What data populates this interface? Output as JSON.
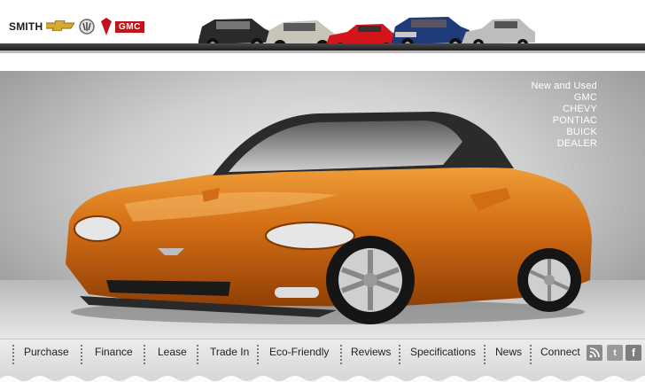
{
  "header": {
    "dealer_name": "SMITH",
    "brands": [
      {
        "name": "Chevrolet",
        "icon": "chevy-bowtie-icon"
      },
      {
        "name": "Buick",
        "icon": "buick-shield-icon"
      },
      {
        "name": "Pontiac",
        "icon": "pontiac-arrowhead-icon"
      },
      {
        "name": "GMC",
        "icon": "gmc-logo-icon",
        "text": "GMC"
      }
    ],
    "lineup_colors": [
      "#2a2a2a",
      "#c9c4b8",
      "#d4161c",
      "#1f3b7a",
      "#bdbdbd"
    ]
  },
  "hero": {
    "lines": [
      "New and Used",
      "GMC",
      "CHEVY",
      "PONTIAC",
      "BUICK",
      "DEALER"
    ],
    "car_color": "#d36d14"
  },
  "nav": {
    "items": [
      "Purchase",
      "Finance",
      "Lease",
      "Trade In",
      "Eco-Friendly",
      "Reviews",
      "Specifications",
      "News",
      "Connect"
    ]
  },
  "social": {
    "icons": [
      "rss-icon",
      "twitter-icon",
      "facebook-icon"
    ],
    "twitter_glyph": "t",
    "facebook_glyph": "f"
  }
}
